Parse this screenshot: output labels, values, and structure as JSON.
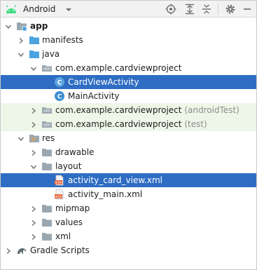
{
  "toolbar": {
    "view_label": "Android",
    "icons": [
      "android-icon",
      "dropdown-caret-icon",
      "locate-target-icon",
      "expand-all-icon",
      "collapse-all-icon",
      "settings-gear-icon",
      "minimize-icon"
    ]
  },
  "tree": {
    "app": "app",
    "manifests": "manifests",
    "java": "java",
    "pkg_main": "com.example.cardviewproject",
    "card_view_activity": "CardViewActivity",
    "main_activity": "MainActivity",
    "pkg_android_test": "com.example.cardviewproject",
    "pkg_android_test_suffix": "(androidTest)",
    "pkg_test": "com.example.cardviewproject",
    "pkg_test_suffix": "(test)",
    "res": "res",
    "drawable": "drawable",
    "layout": "layout",
    "activity_card_view_xml": "activity_card_view.xml",
    "activity_main_xml": "activity_main.xml",
    "mipmap": "mipmap",
    "values": "values",
    "xml": "xml",
    "gradle_scripts": "Gradle Scripts"
  },
  "colors": {
    "selection": "#2e6dc3",
    "test_row": "#eef6e8",
    "folder": "#4aa3df",
    "folder_plain": "#9aa7b0",
    "class_icon": "#3d8fd1",
    "android_green": "#3ddc84"
  }
}
